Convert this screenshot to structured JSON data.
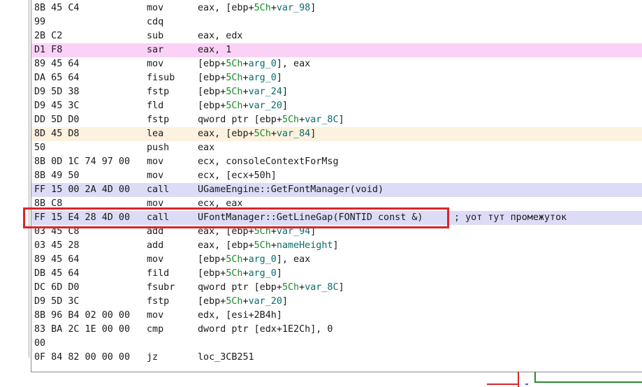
{
  "code_rows": [
    {
      "bytes": "8B 45 C4",
      "mnemonic": "mov",
      "operands": "eax, [ebp+5Ch+var_98]",
      "highlight": "none"
    },
    {
      "bytes": "99",
      "mnemonic": "cdq",
      "operands": "",
      "highlight": "none"
    },
    {
      "bytes": "2B C2",
      "mnemonic": "sub",
      "operands": "eax, edx",
      "highlight": "none"
    },
    {
      "bytes": "D1 F8",
      "mnemonic": "sar",
      "operands": "eax, 1",
      "highlight": "pink"
    },
    {
      "bytes": "89 45 64",
      "mnemonic": "mov",
      "operands": "[ebp+5Ch+arg_0], eax",
      "highlight": "none"
    },
    {
      "bytes": "DA 65 64",
      "mnemonic": "fisub",
      "operands": "[ebp+5Ch+arg_0]",
      "highlight": "none"
    },
    {
      "bytes": "D9 5D 38",
      "mnemonic": "fstp",
      "operands": "[ebp+5Ch+var_24]",
      "highlight": "none"
    },
    {
      "bytes": "D9 45 3C",
      "mnemonic": "fld",
      "operands": "[ebp+5Ch+var_20]",
      "highlight": "none"
    },
    {
      "bytes": "DD 5D D0",
      "mnemonic": "fstp",
      "operands": "qword ptr [ebp+5Ch+var_8C]",
      "highlight": "none"
    },
    {
      "bytes": "8D 45 D8",
      "mnemonic": "lea",
      "operands": "eax, [ebp+5Ch+var_84]",
      "highlight": "orange"
    },
    {
      "bytes": "50",
      "mnemonic": "push",
      "operands": "eax",
      "highlight": "none"
    },
    {
      "bytes": "8B 0D 1C 74 97 00",
      "mnemonic": "mov",
      "operands": "ecx, consoleContextForMsg",
      "highlight": "none"
    },
    {
      "bytes": "8B 49 50",
      "mnemonic": "mov",
      "operands": "ecx, [ecx+50h]",
      "highlight": "none"
    },
    {
      "bytes": "FF 15 00 2A 4D 00",
      "mnemonic": "call",
      "operands": "UGameEngine::GetFontManager(void)",
      "highlight": "blue"
    },
    {
      "bytes": "8B C8",
      "mnemonic": "mov",
      "operands": "ecx, eax",
      "highlight": "none"
    },
    {
      "bytes": "FF 15 E4 28 4D 00",
      "mnemonic": "call",
      "operands": "UFontManager::GetLineGap(FONTID const &)",
      "comment": "; уот тут промежуток",
      "highlight": "blue"
    },
    {
      "bytes": "03 45 C8",
      "mnemonic": "add",
      "operands": "eax, [ebp+5Ch+var_94]",
      "highlight": "none"
    },
    {
      "bytes": "03 45 28",
      "mnemonic": "add",
      "operands": "eax, [ebp+5Ch+nameHeight]",
      "highlight": "none"
    },
    {
      "bytes": "89 45 64",
      "mnemonic": "mov",
      "operands": "[ebp+5Ch+arg_0], eax",
      "highlight": "none"
    },
    {
      "bytes": "DB 45 64",
      "mnemonic": "fild",
      "operands": "[ebp+5Ch+arg_0]",
      "highlight": "none"
    },
    {
      "bytes": "DC 6D D0",
      "mnemonic": "fsubr",
      "operands": "qword ptr [ebp+5Ch+var_8C]",
      "highlight": "none"
    },
    {
      "bytes": "D9 5D 3C",
      "mnemonic": "fstp",
      "operands": "[ebp+5Ch+var_20]",
      "highlight": "none"
    },
    {
      "bytes": "8B 96 B4 02 00 00",
      "mnemonic": "mov",
      "operands": "edx, [esi+2B4h]",
      "highlight": "none"
    },
    {
      "bytes": "83 BA 2C 1E 00 00",
      "mnemonic": "cmp",
      "operands": "dword ptr [edx+1E2Ch], 0",
      "highlight": "none"
    },
    {
      "bytes": "00",
      "mnemonic": "",
      "operands": "",
      "highlight": "none"
    },
    {
      "bytes": "0F 84 82 00 00 00",
      "mnemonic": "jz",
      "operands": "loc_3CB251",
      "highlight": "none"
    }
  ],
  "colors": {
    "pink": "#fbd2f7",
    "orange": "#fdf1df",
    "blue": "#dcdcf7",
    "annotation_box": "#d8262b",
    "edge_red": "#d8262b",
    "edge_green": "#2a8a2a"
  }
}
